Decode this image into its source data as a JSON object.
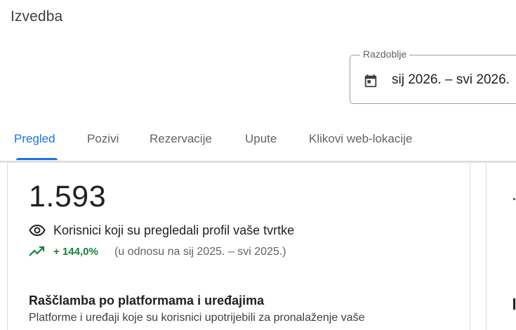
{
  "header": {
    "title": "Izvedba"
  },
  "date_range": {
    "label": "Razdoblje",
    "value": "sij 2026. – svi 2026.",
    "icon": "calendar-icon"
  },
  "tabs": [
    {
      "label": "Pregled",
      "active": true
    },
    {
      "label": "Pozivi",
      "active": false
    },
    {
      "label": "Rezervacije",
      "active": false
    },
    {
      "label": "Upute",
      "active": false
    },
    {
      "label": "Klikovi web-lokacije",
      "active": false
    }
  ],
  "metric": {
    "value": "1.593",
    "label": "Korisnici koji su pregledali profil vaše tvrtke",
    "label_icon": "eye-icon",
    "change": "+ 144,0%",
    "change_icon": "trending-up-icon",
    "comparison": "(u odnosu na sij 2025. – svi 2025.)"
  },
  "breakdown": {
    "heading": "Raščlamba po platformama i uređajima",
    "description": "Platforme i uređaji koje su korisnici upotrijebili za pronalaženje vaše"
  },
  "colors": {
    "accent": "#1a73e8",
    "positive": "#188038",
    "text_primary": "#202124",
    "text_secondary": "#5f6368",
    "border": "#dadce0"
  }
}
